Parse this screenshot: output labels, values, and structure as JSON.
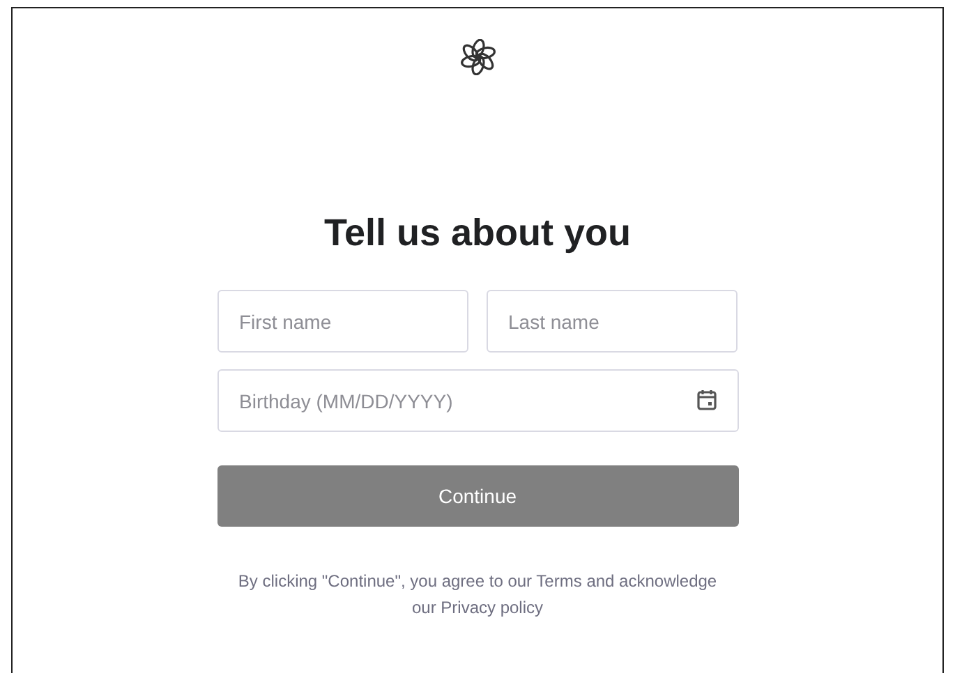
{
  "title": "Tell us about you",
  "fields": [
    {
      "placeholder": "First name"
    },
    {
      "placeholder": "Last name"
    }
  ],
  "birthday": {
    "placeholder": "Birthday (MM/DD/YYYY)"
  },
  "button": {
    "label": "Continue",
    "disabled": true
  },
  "legal": {
    "before": "By clicking \"Continue\", you agree to our",
    "terms": "Terms",
    "middle": "and acknowledge our",
    "privacy": "Privacy policy"
  }
}
